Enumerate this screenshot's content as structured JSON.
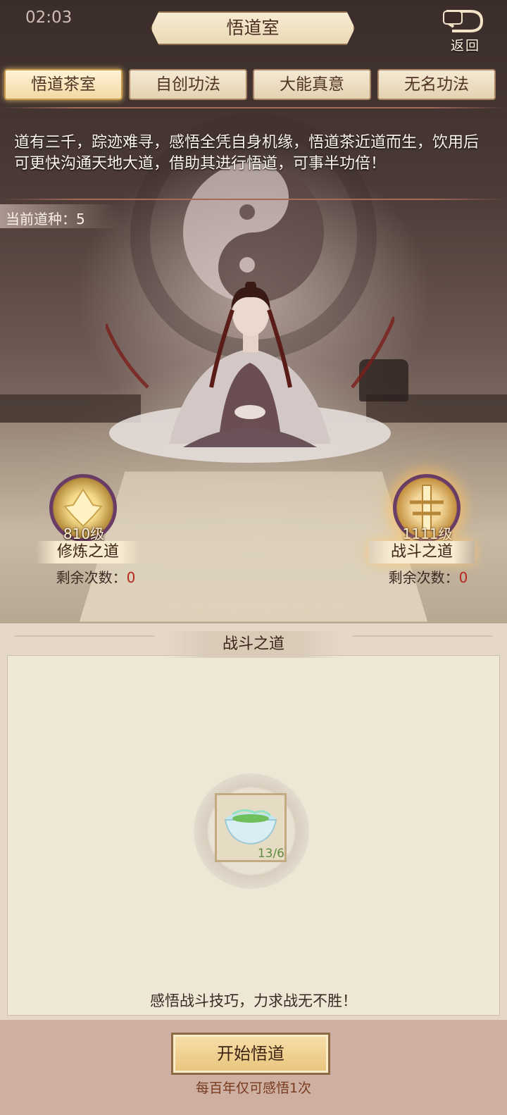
{
  "status_bar": {
    "time": "02:03"
  },
  "header": {
    "title": "悟道室",
    "back_label": "返回"
  },
  "tabs": [
    {
      "label": "悟道茶室",
      "active": true
    },
    {
      "label": "自创功法",
      "active": false
    },
    {
      "label": "大能真意",
      "active": false
    },
    {
      "label": "无名功法",
      "active": false
    }
  ],
  "intro_text": "道有三千，踪迹难寻，感悟全凭自身机缘，悟道茶近道而生，饮用后可更快沟通天地大道，借助其进行悟道，可事半功倍！",
  "dao_seed": "当前道种：5",
  "daos": [
    {
      "level": "810级",
      "name": "修炼之道",
      "remaining_label": "剩余次数：",
      "remaining": "0",
      "selected": false,
      "icon": "cultivation-emblem-icon"
    },
    {
      "level": "1111级",
      "name": "战斗之道",
      "remaining_label": "剩余次数：",
      "remaining": "0",
      "selected": true,
      "icon": "combat-emblem-icon"
    }
  ],
  "panel": {
    "title": "战斗之道",
    "item": {
      "icon": "tea-bowl-icon",
      "count": "13/6"
    },
    "description": "感悟战斗技巧，力求战无不胜！",
    "start_button": "开始悟道",
    "limit_note": "每百年仅可感悟1次"
  },
  "colors": {
    "accent_gold": "#e9c37b",
    "remaining_red": "#b8261e",
    "count_green": "#5f8b3e"
  }
}
